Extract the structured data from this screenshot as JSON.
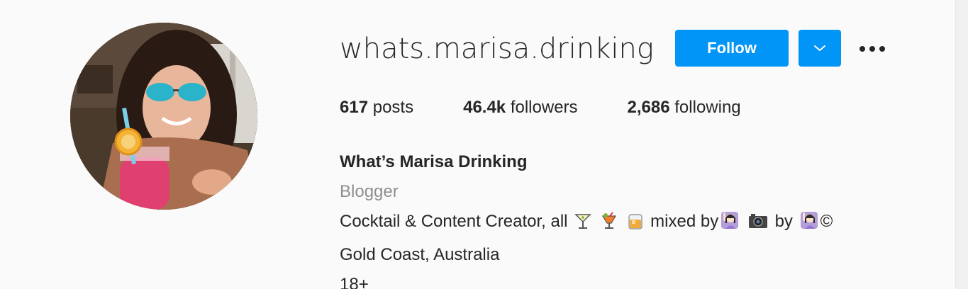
{
  "profile": {
    "username": "whats.marisa.drinking",
    "follow_label": "Follow",
    "stats": {
      "posts_count": "617",
      "posts_label": "posts",
      "followers_count": "46.4k",
      "followers_label": "followers",
      "following_count": "2,686",
      "following_label": "following"
    },
    "bio": {
      "name": "What’s Marisa Drinking",
      "category": "Blogger",
      "line1_prefix": "Cocktail & Content Creator, all",
      "line1_mid": "mixed by",
      "line1_by": "by",
      "line1_suffix": "©",
      "location": "Gold Coast, Australia",
      "age": "18+"
    }
  },
  "icons": {
    "dropdown": "chevron-down-icon",
    "more": "more-options-icon",
    "emojis": [
      "cocktail-glass-emoji",
      "tropical-drink-emoji",
      "tumbler-glass-emoji",
      "woman-raising-hand-emoji",
      "camera-emoji",
      "woman-raising-hand-emoji"
    ]
  },
  "colors": {
    "accent": "#0095f6",
    "text": "#262626",
    "muted": "#8e8e8e",
    "background": "#fafafa"
  }
}
